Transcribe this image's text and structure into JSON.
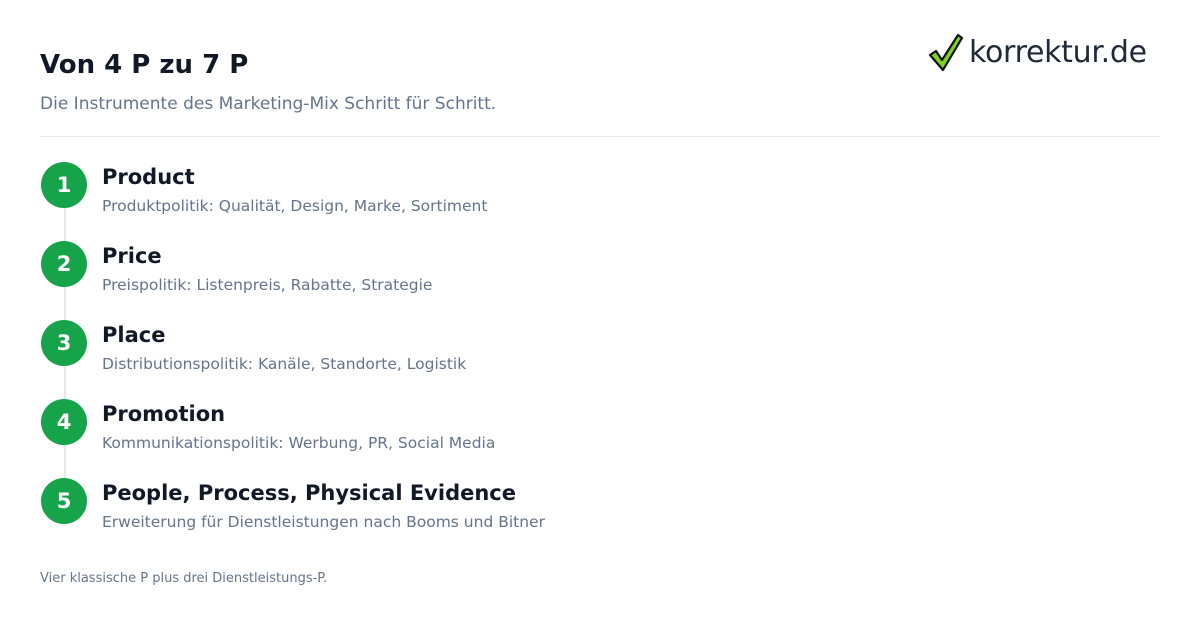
{
  "header": {
    "title": "Von 4 P zu 7 P",
    "subtitle": "Die Instrumente des Marketing-Mix Schritt für Schritt."
  },
  "logo": {
    "icon": "checkmark-icon",
    "text": "korrektur.de",
    "check_color": "#7ed321"
  },
  "colors": {
    "accent": "#17a34a",
    "connector": "#e2e8f0",
    "muted_text": "#64748b"
  },
  "steps": [
    {
      "number": "1",
      "title": "Product",
      "description": "Produktpolitik: Qualität, Design, Marke, Sortiment"
    },
    {
      "number": "2",
      "title": "Price",
      "description": "Preispolitik: Listenpreis, Rabatte, Strategie"
    },
    {
      "number": "3",
      "title": "Place",
      "description": "Distributionspolitik: Kanäle, Standorte, Logistik"
    },
    {
      "number": "4",
      "title": "Promotion",
      "description": "Kommunikationspolitik: Werbung, PR, Social Media"
    },
    {
      "number": "5",
      "title": "People, Process, Physical Evidence",
      "description": "Erweiterung für Dienstleistungen nach Booms und Bitner"
    }
  ],
  "footnote": "Vier klassische P plus drei Dienstleistungs-P."
}
